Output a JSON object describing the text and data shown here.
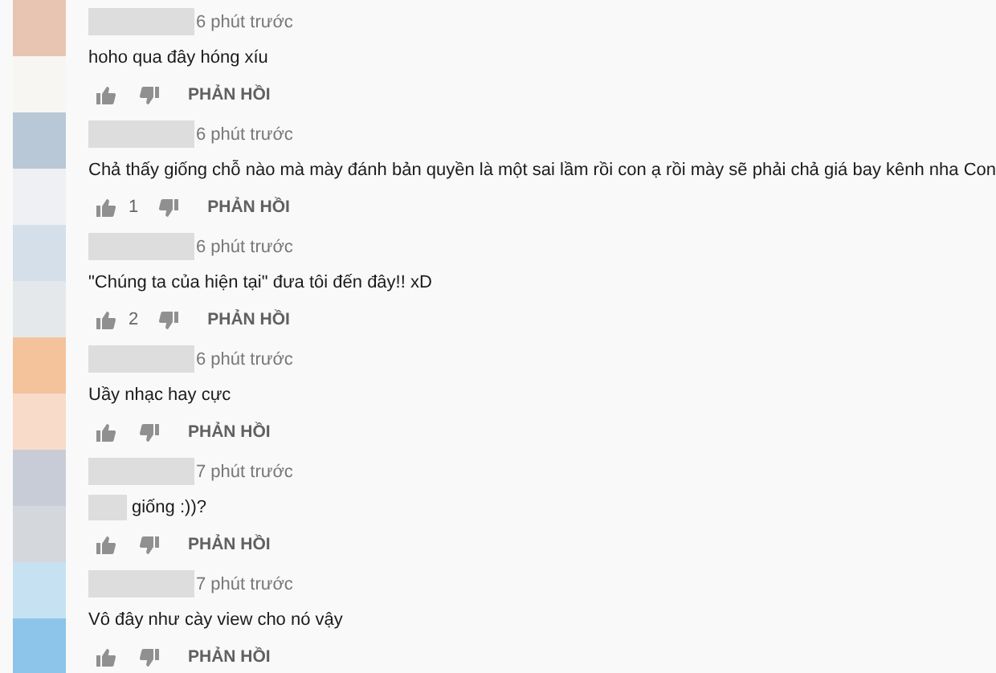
{
  "comments": [
    {
      "avatar_blocks": [
        {
          "color": "#e8c4b3"
        },
        {
          "color": "#f8f6f3"
        }
      ],
      "time": "6 phút trước",
      "text": "hoho qua đây hóng xíu",
      "redacted_prefix": false,
      "reply_label": "PHẢN HỒI"
    },
    {
      "avatar_blocks": [
        {
          "color": "#b9c8d6"
        },
        {
          "color": "#eff0f3"
        }
      ],
      "time": "6 phút trước",
      "text": "Chả thấy giống chỗ nào mà mày đánh bản quyền là một sai lầm rồi con ạ  rồi mày sẽ phải chả giá bay kênh nha Con",
      "redacted_prefix": false,
      "like_count": "1",
      "reply_label": "PHẢN HỒI"
    },
    {
      "avatar_blocks": [
        {
          "color": "#d5dfea"
        },
        {
          "color": "#e5e8ea"
        }
      ],
      "time": "6 phút trước",
      "text": "\"Chúng ta của hiện tại\" đưa tôi đến đây!! xD",
      "redacted_prefix": false,
      "like_count": "2",
      "reply_label": "PHẢN HỒI"
    },
    {
      "avatar_blocks": [
        {
          "color": "#f4c39c"
        },
        {
          "color": "#f8dbc8"
        }
      ],
      "time": "6 phút trước",
      "text": "Uầy nhạc hay cực",
      "redacted_prefix": false,
      "reply_label": "PHẢN HỒI"
    },
    {
      "avatar_blocks": [
        {
          "color": "#c8ccd7"
        },
        {
          "color": "#d4d7dc"
        }
      ],
      "time": "7 phút trước",
      "text": "giống :))?",
      "redacted_prefix": true,
      "reply_label": "PHẢN HỒI"
    },
    {
      "avatar_blocks": [
        {
          "color": "#c6e2f2"
        },
        {
          "color": "#8cc5e9"
        }
      ],
      "time": "7 phút trước",
      "text": "Vô đây như cày view cho nó vậy",
      "redacted_prefix": false,
      "reply_label": "PHẢN HỒI"
    }
  ]
}
